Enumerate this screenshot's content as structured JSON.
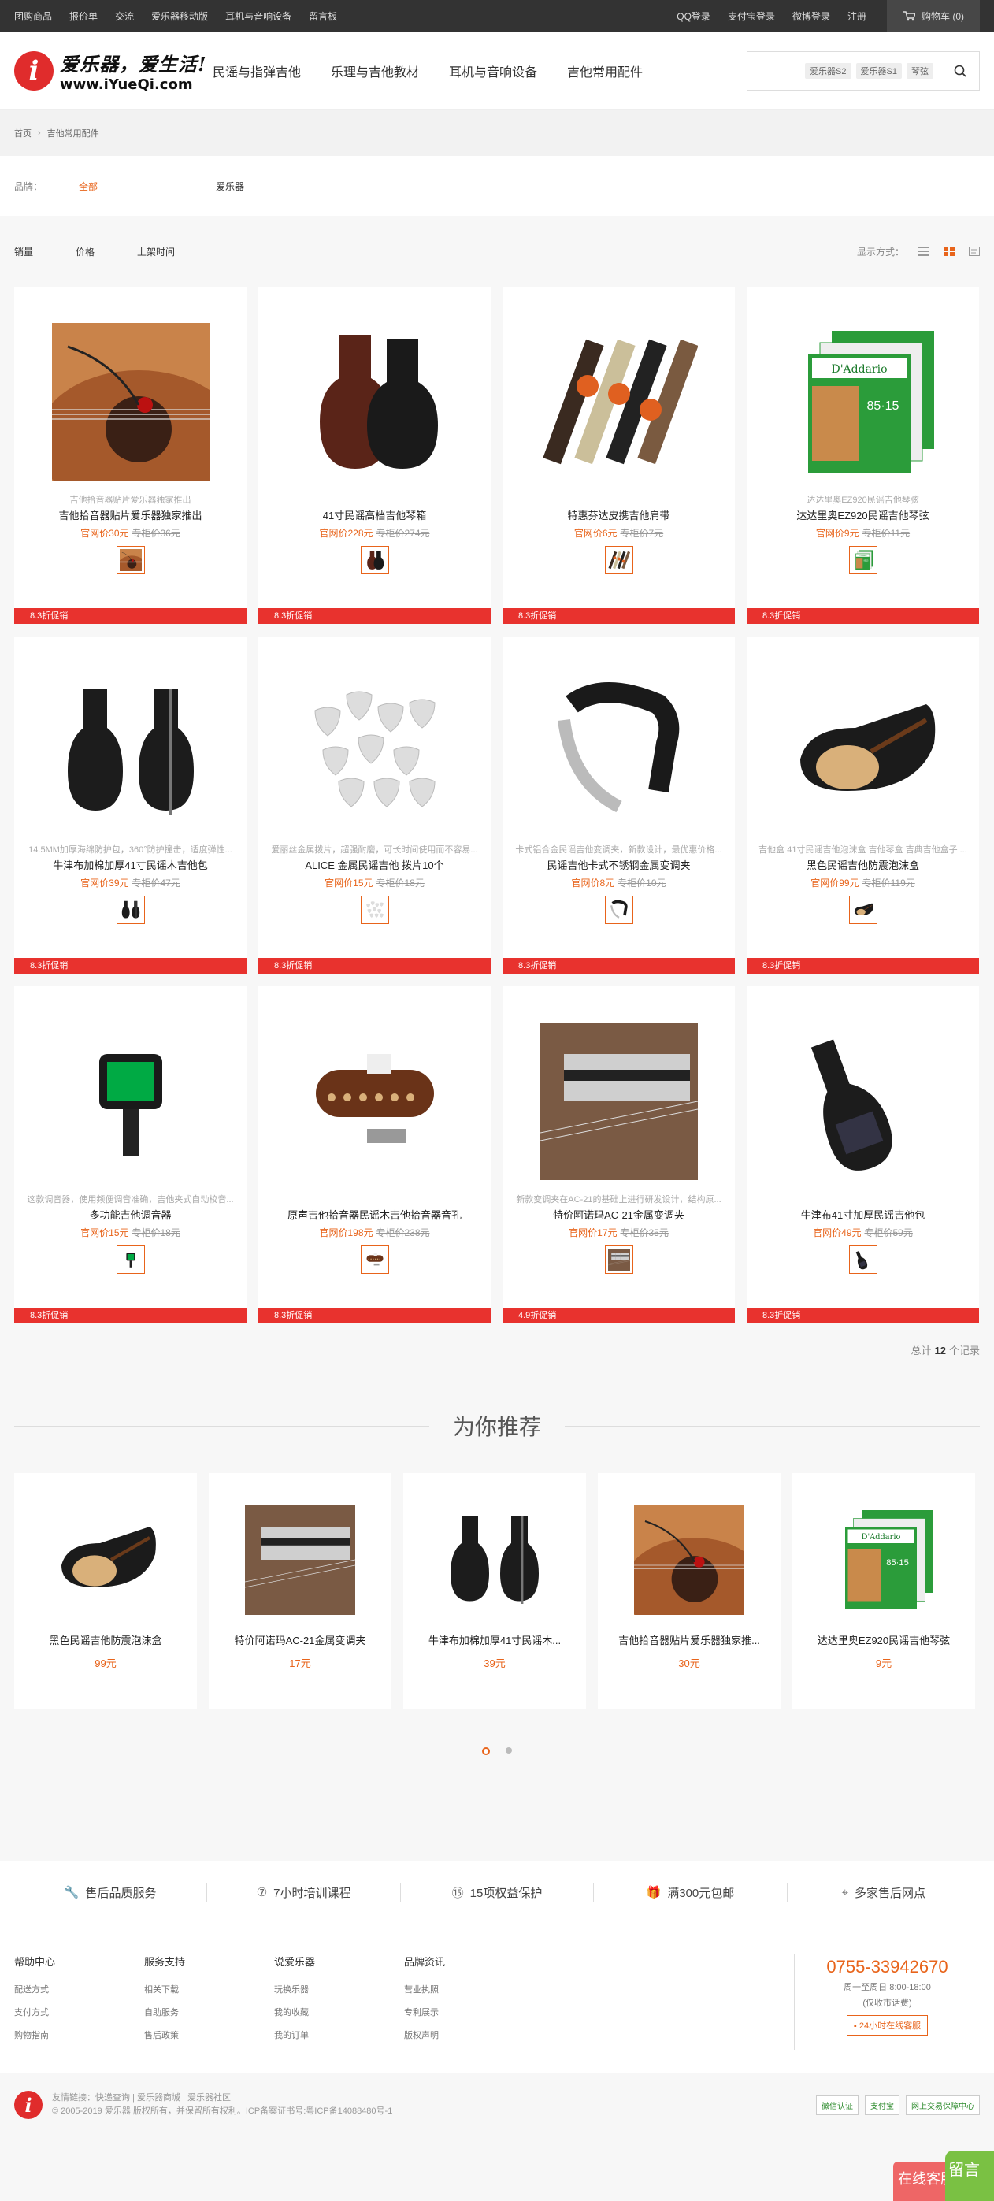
{
  "topbar": {
    "links": [
      "团购商品",
      "报价单",
      "交流",
      "爱乐器移动版",
      "耳机与音响设备",
      "留言板"
    ],
    "right": [
      "QQ登录",
      "支付宝登录",
      "微博登录",
      "注册"
    ],
    "cart": "购物车 (0)"
  },
  "logo": {
    "line1": "爱乐器，爱生活!",
    "line2": "www.iYueQi.com"
  },
  "nav": [
    "民谣与指弹吉他",
    "乐理与吉他教材",
    "耳机与音响设备",
    "吉他常用配件"
  ],
  "search": {
    "tags": [
      "爱乐器S2",
      "爱乐器S1",
      "琴弦"
    ]
  },
  "breadcrumb": [
    "首页",
    "吉他常用配件"
  ],
  "brand": {
    "label": "品牌：",
    "all": "全部",
    "item": "爱乐器"
  },
  "sort": {
    "items": [
      "销量",
      "价格",
      "上架时间"
    ],
    "view_label": "显示方式："
  },
  "products": [
    {
      "sub": "吉他拾音器贴片爱乐器独家推出",
      "name": "吉他拾音器贴片爱乐器独家推出",
      "price": "官网价30元",
      "old": "专柜价36元",
      "promo": "8.3折促销",
      "kind": "guitar-pickup"
    },
    {
      "sub": "",
      "name": "41寸民谣高档吉他琴箱",
      "price": "官网价228元",
      "old": "专柜价274元",
      "promo": "8.3折促销",
      "kind": "case"
    },
    {
      "sub": "",
      "name": "特惠芬达皮携吉他肩带",
      "price": "官网价6元",
      "old": "专柜价7元",
      "promo": "8.3折促销",
      "kind": "straps"
    },
    {
      "sub": "达达里奥EZ920民谣吉他琴弦",
      "name": "达达里奥EZ920民谣吉他琴弦",
      "price": "官网价9元",
      "old": "专柜价11元",
      "promo": "8.3折促销",
      "kind": "strings"
    },
    {
      "sub": "14.5MM加厚海绵防护包，360°防护撞击，适度弹性...",
      "name": "牛津布加棉加厚41寸民谣木吉他包",
      "price": "官网价39元",
      "old": "专柜价47元",
      "promo": "8.3折促销",
      "kind": "bags"
    },
    {
      "sub": "爱丽丝金属拨片，超强耐磨，可长时间使用而不容易...",
      "name": "ALICE 金属民谣吉他 拨片10个",
      "price": "官网价15元",
      "old": "专柜价18元",
      "promo": "8.3折促销",
      "kind": "picks"
    },
    {
      "sub": "卡式铝合金民谣吉他变调夹，新款设计，最优惠价格...",
      "name": "民谣吉他卡式不锈钢金属变调夹",
      "price": "官网价8元",
      "old": "专柜价10元",
      "promo": "8.3折促销",
      "kind": "capo"
    },
    {
      "sub": "吉他盒 41寸民谣吉他泡沫盒 吉他琴盒 吉典吉他盒子 ...",
      "name": "黑色民谣吉他防震泡沫盒",
      "price": "官网价99元",
      "old": "专柜价119元",
      "promo": "8.3折促销",
      "kind": "foam"
    },
    {
      "sub": "这款调音器，使用频便调音准确，吉他夹式自动校音...",
      "name": "多功能吉他调音器",
      "price": "官网价15元",
      "old": "专柜价18元",
      "promo": "8.3折促销",
      "kind": "tuner"
    },
    {
      "sub": "",
      "name": "原声吉他拾音器民谣木吉他拾音器音孔",
      "price": "官网价198元",
      "old": "专柜价238元",
      "promo": "8.3折促销",
      "kind": "soundhole"
    },
    {
      "sub": "新款变调夹在AC-21的基础上进行研发设计，结构原...",
      "name": "特价阿诺玛AC-21金属变调夹",
      "price": "官网价17元",
      "old": "专柜价35元",
      "promo": "4.9折促销",
      "kind": "capos"
    },
    {
      "sub": "",
      "name": "牛津布41寸加厚民谣吉他包",
      "price": "官网价49元",
      "old": "专柜价59元",
      "promo": "8.3折促销",
      "kind": "bag1"
    }
  ],
  "total": {
    "prefix": "总计",
    "count": "12",
    "suffix": "个记录"
  },
  "recommend": {
    "title": "为你推荐",
    "items": [
      {
        "name": "黑色民谣吉他防震泡沫盒",
        "price": "99元",
        "kind": "foam"
      },
      {
        "name": "特价阿诺玛AC-21金属变调夹",
        "price": "17元",
        "kind": "capos"
      },
      {
        "name": "牛津布加棉加厚41寸民谣木...",
        "price": "39元",
        "kind": "bags"
      },
      {
        "name": "吉他拾音器贴片爱乐器独家推...",
        "price": "30元",
        "kind": "guitar-pickup"
      },
      {
        "name": "达达里奥EZ920民谣吉他琴弦",
        "price": "9元",
        "kind": "strings"
      }
    ]
  },
  "services": [
    "售后品质服务",
    "7小时培训课程",
    "15项权益保护",
    "满300元包邮",
    "多家售后网点"
  ],
  "footer": {
    "cols": [
      {
        "title": "帮助中心",
        "links": [
          "配送方式",
          "支付方式",
          "购物指南"
        ]
      },
      {
        "title": "服务支持",
        "links": [
          "相关下载",
          "自助服务",
          "售后政策"
        ]
      },
      {
        "title": "说爱乐器",
        "links": [
          "玩换乐器",
          "我的收藏",
          "我的订单"
        ]
      },
      {
        "title": "品牌资讯",
        "links": [
          "营业执照",
          "专利展示",
          "版权声明"
        ]
      }
    ],
    "phone": "0755-33942670",
    "hours": "周一至周日 8:00-18:00",
    "hours2": "(仅收市话费)",
    "cs": "24小时在线客服"
  },
  "bottom": {
    "links": "友情链接：快递查询 | 爱乐器商城 | 爱乐器社区",
    "copy": "© 2005-2019 爱乐器 版权所有，并保留所有权利。ICP备案证书号:粤ICP备14088480号-1",
    "badges": [
      "微信认证",
      "支付宝",
      "网上交易保障中心"
    ]
  },
  "float": {
    "a": "在线客服",
    "b": "留言"
  },
  "colors": {
    "accent": "#e8641b",
    "promo": "#e8322e"
  }
}
